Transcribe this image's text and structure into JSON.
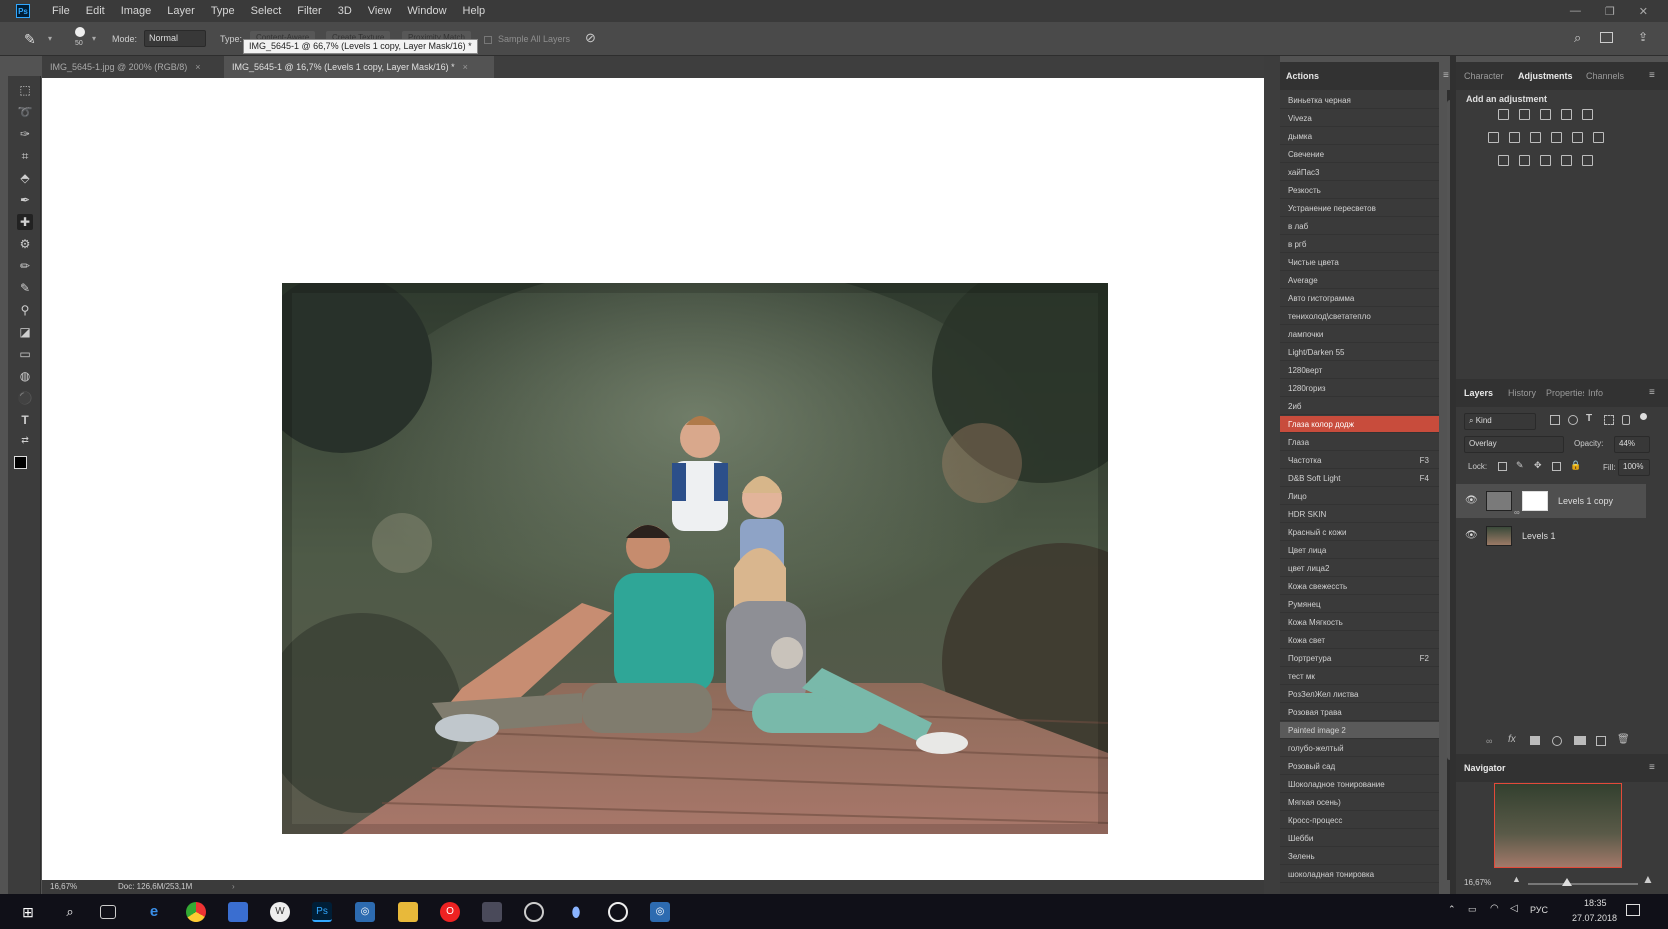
{
  "menu": {
    "logo": "Ps",
    "items": [
      "File",
      "Edit",
      "Image",
      "Layer",
      "Type",
      "Select",
      "Filter",
      "3D",
      "View",
      "Window",
      "Help"
    ]
  },
  "window_controls": {
    "minimize": "—",
    "restore": "❐",
    "close": "✕"
  },
  "options_bar": {
    "brush_size": "50",
    "mode_label": "Mode:",
    "mode_value": "Normal",
    "type_label": "Type:",
    "btn_content_aware": "Content-Aware",
    "btn_create_texture": "Create Texture",
    "btn_proximity_match": "Proximity Match",
    "sample_all_layers": "Sample All Layers"
  },
  "tooltip": "IMG_5645-1 @ 66,7% (Levels 1 copy, Layer Mask/16) *",
  "doc_tabs": [
    {
      "label": "IMG_5645-1.jpg @ 200% (RGB/8)",
      "close": "×",
      "active": false
    },
    {
      "label": "IMG_5645-1 @ 16,7% (Levels 1 copy, Layer Mask/16) *",
      "close": "×",
      "active": true
    }
  ],
  "status_bar": {
    "zoom": "16,67%",
    "doc": "Doc: 126,6M/253,1M"
  },
  "actions_panel": {
    "title": "Actions",
    "items": [
      {
        "label": "Виньетка черная",
        "key": "",
        "state": ""
      },
      {
        "label": "Viveza",
        "key": "",
        "state": ""
      },
      {
        "label": "дымка",
        "key": "",
        "state": ""
      },
      {
        "label": "Свечение",
        "key": "",
        "state": ""
      },
      {
        "label": "хайПас3",
        "key": "",
        "state": ""
      },
      {
        "label": "Резкость",
        "key": "",
        "state": ""
      },
      {
        "label": "Устранение пересветов",
        "key": "",
        "state": ""
      },
      {
        "label": "в лаб",
        "key": "",
        "state": ""
      },
      {
        "label": "в ргб",
        "key": "",
        "state": ""
      },
      {
        "label": "Чистые цвета",
        "key": "",
        "state": ""
      },
      {
        "label": "Average",
        "key": "",
        "state": ""
      },
      {
        "label": "Авто гистограмма",
        "key": "",
        "state": ""
      },
      {
        "label": "тенихолод\\светатепло",
        "key": "",
        "state": ""
      },
      {
        "label": "лампочки",
        "key": "",
        "state": ""
      },
      {
        "label": "Light/Darken 55",
        "key": "",
        "state": ""
      },
      {
        "label": "1280верт",
        "key": "",
        "state": ""
      },
      {
        "label": "1280гориз",
        "key": "",
        "state": ""
      },
      {
        "label": "2иб",
        "key": "",
        "state": ""
      },
      {
        "label": "Глаза колор додж",
        "key": "",
        "state": "sel"
      },
      {
        "label": "Глаза",
        "key": "",
        "state": ""
      },
      {
        "label": "Частотка",
        "key": "F3",
        "state": ""
      },
      {
        "label": "D&B Soft Light",
        "key": "F4",
        "state": ""
      },
      {
        "label": "Лицо",
        "key": "",
        "state": ""
      },
      {
        "label": "HDR SKIN",
        "key": "",
        "state": ""
      },
      {
        "label": "Красный с кожи",
        "key": "",
        "state": ""
      },
      {
        "label": "Цвет лица",
        "key": "",
        "state": ""
      },
      {
        "label": "цвет лица2",
        "key": "",
        "state": ""
      },
      {
        "label": "Кожа свежессть",
        "key": "",
        "state": ""
      },
      {
        "label": "Румянец",
        "key": "",
        "state": ""
      },
      {
        "label": "Кожа Мягкость",
        "key": "",
        "state": ""
      },
      {
        "label": "Кожа свет",
        "key": "",
        "state": ""
      },
      {
        "label": "Портретура",
        "key": "F2",
        "state": ""
      },
      {
        "label": "тест мк",
        "key": "",
        "state": ""
      },
      {
        "label": "РозЗелЖел листва",
        "key": "",
        "state": ""
      },
      {
        "label": "Розовая трава",
        "key": "",
        "state": ""
      },
      {
        "label": "Painted image 2",
        "key": "",
        "state": "hl"
      },
      {
        "label": "голубо-желтый",
        "key": "",
        "state": ""
      },
      {
        "label": "Розовый сад",
        "key": "",
        "state": ""
      },
      {
        "label": "Шоколадное тонирование",
        "key": "",
        "state": ""
      },
      {
        "label": "Мягкая осень)",
        "key": "",
        "state": ""
      },
      {
        "label": "Кросс-процесс",
        "key": "",
        "state": ""
      },
      {
        "label": "Шебби",
        "key": "",
        "state": ""
      },
      {
        "label": "Зелень",
        "key": "",
        "state": ""
      },
      {
        "label": "шоколадная тонировка",
        "key": "",
        "state": ""
      }
    ]
  },
  "adjustments_panel": {
    "tabs": [
      "Character",
      "Adjustments",
      "Channels"
    ],
    "active_tab": "Adjustments",
    "heading": "Add an adjustment"
  },
  "layers_panel": {
    "tabs": [
      "Layers",
      "History",
      "Properties",
      "Info"
    ],
    "active_tab": "Layers",
    "kind_filter": "Kind",
    "blend_mode": "Overlay",
    "opacity_label": "Opacity:",
    "opacity_value": "44%",
    "lock_label": "Lock:",
    "fill_label": "Fill:",
    "fill_value": "100%",
    "layers": [
      {
        "name": "Levels 1 copy",
        "selected": true
      },
      {
        "name": "Levels 1",
        "selected": false
      }
    ]
  },
  "navigator_panel": {
    "title": "Navigator",
    "zoom": "16,67%"
  },
  "taskbar": {
    "language": "РУС",
    "time": "18:35",
    "date": "27.07.2018"
  },
  "colors": {
    "selected_action": "#c84c3c",
    "ps_blue": "#31a8ff"
  }
}
